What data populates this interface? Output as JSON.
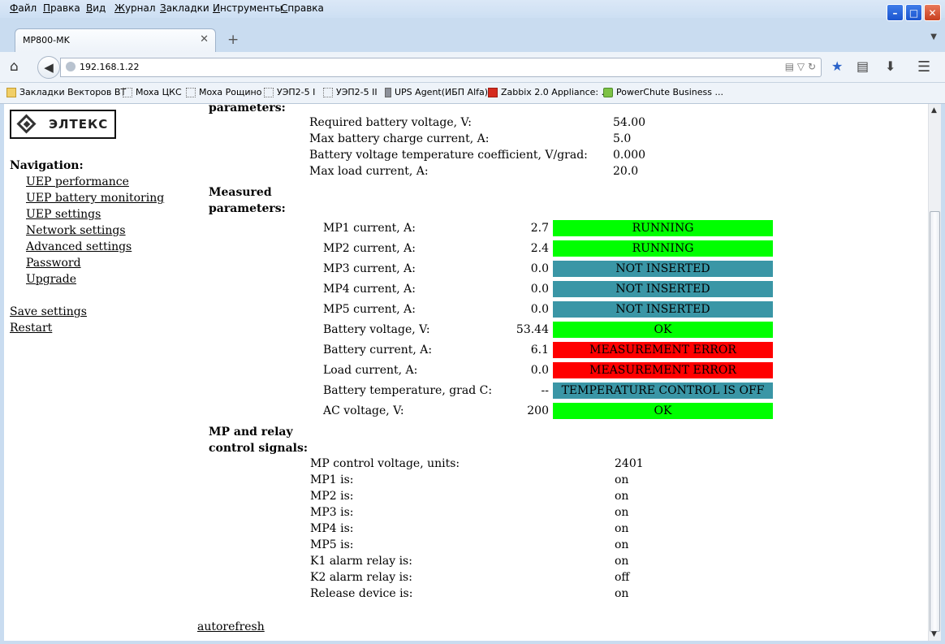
{
  "browser": {
    "menu": [
      "Файл",
      "Правка",
      "Вид",
      "Журнал",
      "Закладки",
      "Инструменты",
      "Справка"
    ],
    "tab_title": "MP800-MK",
    "url": "192.168.1.22",
    "bookmarks": [
      {
        "label": "Закладки Векторов ВТ",
        "icon": "folder-icon"
      },
      {
        "label": "Moxa ЦКС",
        "icon": "page-icon"
      },
      {
        "label": "Moxa Рощино",
        "icon": "page-icon"
      },
      {
        "label": "УЭП2-5 I",
        "icon": "page-icon"
      },
      {
        "label": "УЭП2-5 II",
        "icon": "page-icon"
      },
      {
        "label": "UPS Agent(ИБП Alfa)",
        "icon": "ups-icon"
      },
      {
        "label": "Zabbix 2.0 Appliance: ...",
        "icon": "zabbix-icon"
      },
      {
        "label": "PowerChute Business ...",
        "icon": "powerchute-icon"
      }
    ]
  },
  "logo": {
    "text": "ЭЛТЕКС"
  },
  "nav": {
    "heading": "Navigation:",
    "links": [
      "UEP performance",
      "UEP battery monitoring",
      "UEP settings",
      "Network settings",
      "Advanced settings",
      "Password",
      "Upgrade"
    ],
    "save": "Save settings",
    "restart": "Restart"
  },
  "battery_params": {
    "heading": "parameters:",
    "rows": [
      {
        "label": "Required battery voltage, V:",
        "value": "54.00"
      },
      {
        "label": "Max battery charge current, A:",
        "value": "5.0"
      },
      {
        "label": "Battery voltage temperature coefficient, V/grad:",
        "value": "0.000"
      },
      {
        "label": "Max load current, A:",
        "value": "20.0"
      }
    ]
  },
  "measured": {
    "heading_line1": "Measured",
    "heading_line2": "parameters:",
    "rows": [
      {
        "label": "MP1 current, A:",
        "value": "2.7",
        "status": "RUNNING",
        "color": "#00ff00"
      },
      {
        "label": "MP2 current, A:",
        "value": "2.4",
        "status": "RUNNING",
        "color": "#00ff00"
      },
      {
        "label": "MP3 current, A:",
        "value": "0.0",
        "status": "NOT INSERTED",
        "color": "#3a96a6"
      },
      {
        "label": "MP4 current, A:",
        "value": "0.0",
        "status": "NOT INSERTED",
        "color": "#3a96a6"
      },
      {
        "label": "MP5 current, A:",
        "value": "0.0",
        "status": "NOT INSERTED",
        "color": "#3a96a6"
      },
      {
        "label": "Battery voltage, V:",
        "value": "53.44",
        "status": "OK",
        "color": "#00ff00"
      },
      {
        "label": "Battery current, A:",
        "value": "6.1",
        "status": "MEASUREMENT ERROR",
        "color": "#ff0000"
      },
      {
        "label": "Load current, A:",
        "value": "0.0",
        "status": "MEASUREMENT ERROR",
        "color": "#ff0000"
      },
      {
        "label": "Battery temperature, grad C:",
        "value": "--",
        "status": "TEMPERATURE CONTROL IS OFF",
        "color": "#3a96a6"
      },
      {
        "label": "AC voltage, V:",
        "value": "200",
        "status": "OK",
        "color": "#00ff00"
      }
    ]
  },
  "control": {
    "heading_line1": "MP and relay",
    "heading_line2": "control signals:",
    "rows": [
      {
        "label": "MP control voltage, units:",
        "value": "2401"
      },
      {
        "label": "MP1 is:",
        "value": "on"
      },
      {
        "label": "MP2 is:",
        "value": "on"
      },
      {
        "label": "MP3 is:",
        "value": "on"
      },
      {
        "label": "MP4 is:",
        "value": "on"
      },
      {
        "label": "MP5 is:",
        "value": "on"
      },
      {
        "label": "K1 alarm relay is:",
        "value": "on"
      },
      {
        "label": "K2 alarm relay is:",
        "value": "off"
      },
      {
        "label": "Release device is:",
        "value": "on"
      }
    ]
  },
  "autorefresh": "autorefresh"
}
